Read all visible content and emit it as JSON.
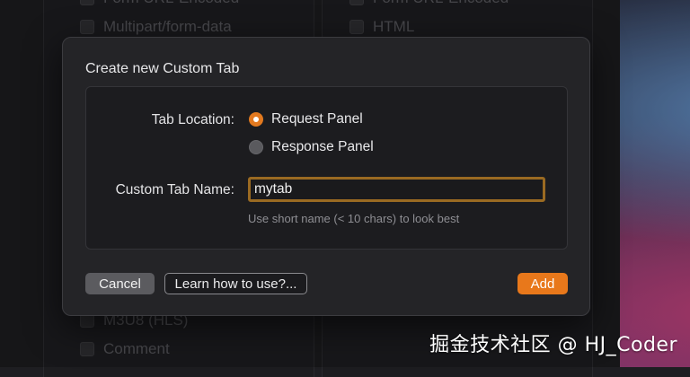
{
  "background": {
    "top_left_option_1": "Form URL-Encoded",
    "top_left_option_2": "Multipart/form-data",
    "top_right_option_1": "Form URL-Encoded",
    "top_right_option_2": "HTML",
    "bottom_left_option_1": "M3U8 (HLS)",
    "bottom_left_option_2": "Comment"
  },
  "dialog": {
    "title": "Create new Custom Tab",
    "tab_location_label": "Tab Location:",
    "options": [
      {
        "label": "Request Panel",
        "selected": true
      },
      {
        "label": "Response Panel",
        "selected": false
      }
    ],
    "name_label": "Custom Tab Name:",
    "name_value": "mytab",
    "hint": "Use short name (< 10 chars) to look best",
    "cancel_label": "Cancel",
    "learn_label": "Learn how to use?...",
    "add_label": "Add"
  },
  "watermark": "掘金技术社区 @ HJ_Coder",
  "colors": {
    "accent": "#e8781b",
    "input_focus": "#9a6a22"
  }
}
